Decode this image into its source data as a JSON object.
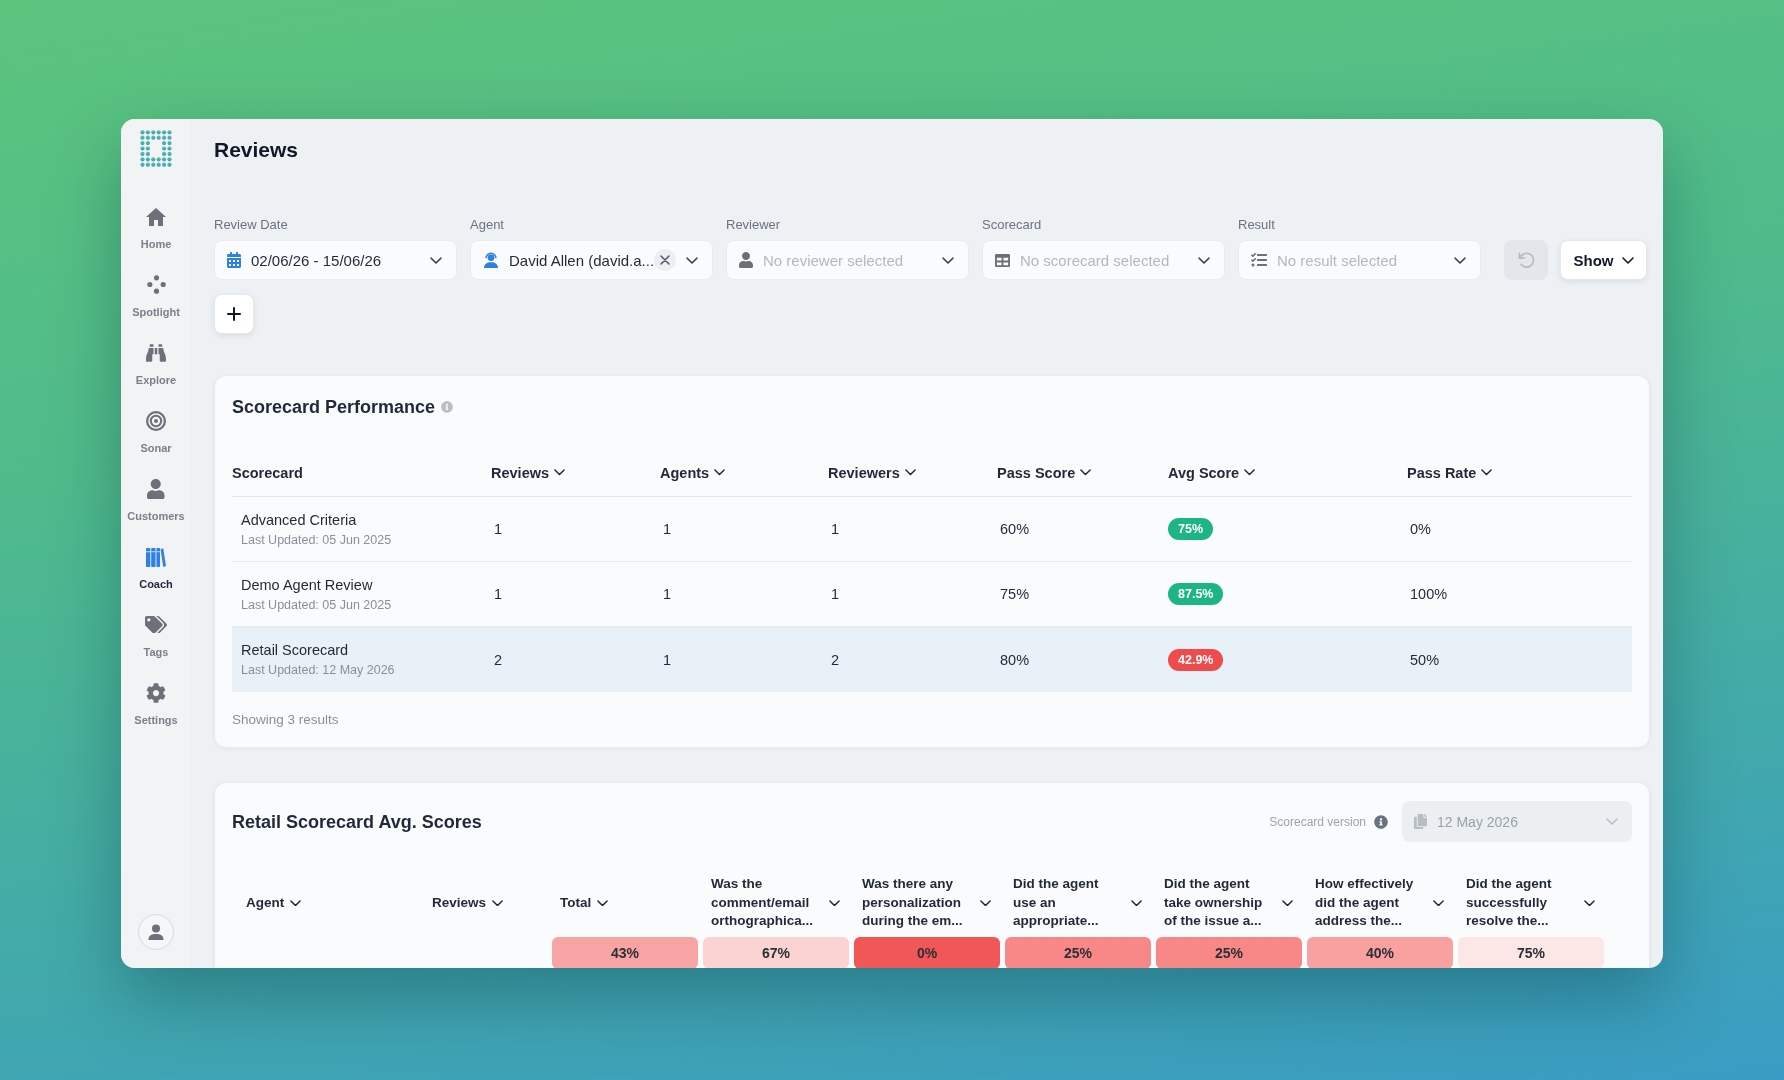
{
  "app": {
    "title": "Reviews"
  },
  "sidebar": {
    "items": [
      {
        "label": "Home",
        "selected": false
      },
      {
        "label": "Spotlight",
        "selected": false
      },
      {
        "label": "Explore",
        "selected": false
      },
      {
        "label": "Sonar",
        "selected": false
      },
      {
        "label": "Customers",
        "selected": false
      },
      {
        "label": "Coach",
        "selected": true
      },
      {
        "label": "Tags",
        "selected": false
      },
      {
        "label": "Settings",
        "selected": false
      }
    ]
  },
  "filters": [
    {
      "label": "Review Date",
      "value": "02/06/26 - 15/06/26",
      "clearable": false
    },
    {
      "label": "Agent",
      "value": "David Allen (david.a...",
      "clearable": true
    },
    {
      "label": "Reviewer",
      "placeholder": "No reviewer selected",
      "clearable": false
    },
    {
      "label": "Scorecard",
      "placeholder": "No scorecard selected",
      "clearable": false
    },
    {
      "label": "Result",
      "placeholder": "No result selected",
      "clearable": false
    }
  ],
  "toolbar": {
    "reset": {
      "disabled": true
    },
    "show": {
      "label": "Show"
    }
  },
  "scorecard_performance": {
    "title": "Scorecard Performance",
    "columns": [
      {
        "label": "Scorecard",
        "sortable": false
      },
      {
        "label": "Reviews",
        "sortable": true
      },
      {
        "label": "Agents",
        "sortable": true
      },
      {
        "label": "Reviewers",
        "sortable": true
      },
      {
        "label": "Pass Score",
        "sortable": true
      },
      {
        "label": "Avg Score",
        "sortable": true
      },
      {
        "label": "Pass Rate",
        "sortable": true
      }
    ],
    "rows": [
      {
        "name": "Advanced Criteria",
        "updated": "Last Updated: 05 Jun 2025",
        "reviews": "1",
        "agents": "1",
        "reviewers": "1",
        "pass_score": "60%",
        "avg_score": {
          "value": "75%",
          "color": "#1db583"
        },
        "pass_rate": "0%",
        "selected": false
      },
      {
        "name": "Demo Agent Review",
        "updated": "Last Updated: 05 Jun 2025",
        "reviews": "1",
        "agents": "1",
        "reviewers": "1",
        "pass_score": "75%",
        "avg_score": {
          "value": "87.5%",
          "color": "#1db583"
        },
        "pass_rate": "100%",
        "selected": false
      },
      {
        "name": "Retail Scorecard",
        "updated": "Last Updated: 12 May 2026",
        "reviews": "2",
        "agents": "1",
        "reviewers": "2",
        "pass_score": "80%",
        "avg_score": {
          "value": "42.9%",
          "color": "#ef4b4b"
        },
        "pass_rate": "50%",
        "selected": true
      }
    ],
    "footer": "Showing 3 results"
  },
  "avg_scores": {
    "title": "Retail Scorecard Avg. Scores",
    "version": {
      "label": "Scorecard version",
      "value": "12 May 2026",
      "disabled": true
    },
    "columns": [
      {
        "label": "Agent",
        "sortable": true
      },
      {
        "label": "Reviews",
        "sortable": true
      },
      {
        "label": "Total",
        "sortable": true
      },
      {
        "label": "Was the comment/email orthographica...",
        "sortable": true
      },
      {
        "label": "Was there any personalization during the em...",
        "sortable": true
      },
      {
        "label": "Did the agent use an appropriate...",
        "sortable": true
      },
      {
        "label": "Did the agent take ownership of the issue a...",
        "sortable": true
      },
      {
        "label": "How effectively did the agent address the...",
        "sortable": true
      },
      {
        "label": "Did the agent successfully resolve the...",
        "sortable": true
      }
    ],
    "summary_scores": [
      {
        "value": "43%",
        "color": "#f9a4a4"
      },
      {
        "value": "67%",
        "color": "#fcd3d3"
      },
      {
        "value": "0%",
        "color": "#f25757"
      },
      {
        "value": "25%",
        "color": "#f88787"
      },
      {
        "value": "25%",
        "color": "#f88787"
      },
      {
        "value": "40%",
        "color": "#f9a0a0"
      },
      {
        "value": "75%",
        "color": "#fde6e6"
      }
    ]
  }
}
